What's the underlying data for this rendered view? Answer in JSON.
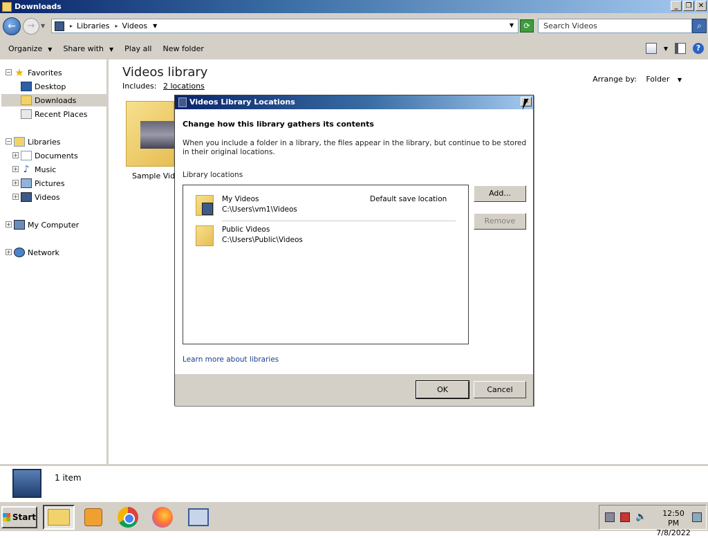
{
  "window": {
    "title": "Downloads",
    "controls": {
      "minimize": "_",
      "maximize": "❐",
      "close": "✕"
    }
  },
  "address": {
    "crumbs": [
      "Libraries",
      "Videos"
    ],
    "search_placeholder": "Search Videos"
  },
  "toolbar": {
    "organize": "Organize",
    "share_with": "Share with",
    "play_all": "Play all",
    "new_folder": "New folder"
  },
  "nav": {
    "favorites": "Favorites",
    "desktop": "Desktop",
    "downloads": "Downloads",
    "recent_places": "Recent Places",
    "libraries": "Libraries",
    "documents": "Documents",
    "music": "Music",
    "pictures": "Pictures",
    "videos": "Videos",
    "my_computer": "My Computer",
    "network": "Network"
  },
  "content": {
    "title": "Videos library",
    "includes_label": "Includes:",
    "includes_link": "2 locations",
    "arrange_label": "Arrange by:",
    "arrange_value": "Folder",
    "items": [
      {
        "name": "Sample Videos"
      }
    ]
  },
  "details": {
    "count": "1 item"
  },
  "dialog": {
    "title": "Videos Library Locations",
    "heading": "Change how this library gathers its contents",
    "description": "When you include a folder in a library, the files appear in the library, but continue to be stored in their original locations.",
    "section_label": "Library locations",
    "locations": [
      {
        "name": "My Videos",
        "path": "C:\\Users\\vm1\\Videos",
        "note": "Default save location"
      },
      {
        "name": "Public Videos",
        "path": "C:\\Users\\Public\\Videos",
        "note": ""
      }
    ],
    "add_button": "Add...",
    "remove_button": "Remove",
    "learn_more": "Learn more about libraries",
    "ok": "OK",
    "cancel": "Cancel"
  },
  "taskbar": {
    "start": "Start",
    "time": "12:50 PM",
    "date": "7/8/2022"
  }
}
